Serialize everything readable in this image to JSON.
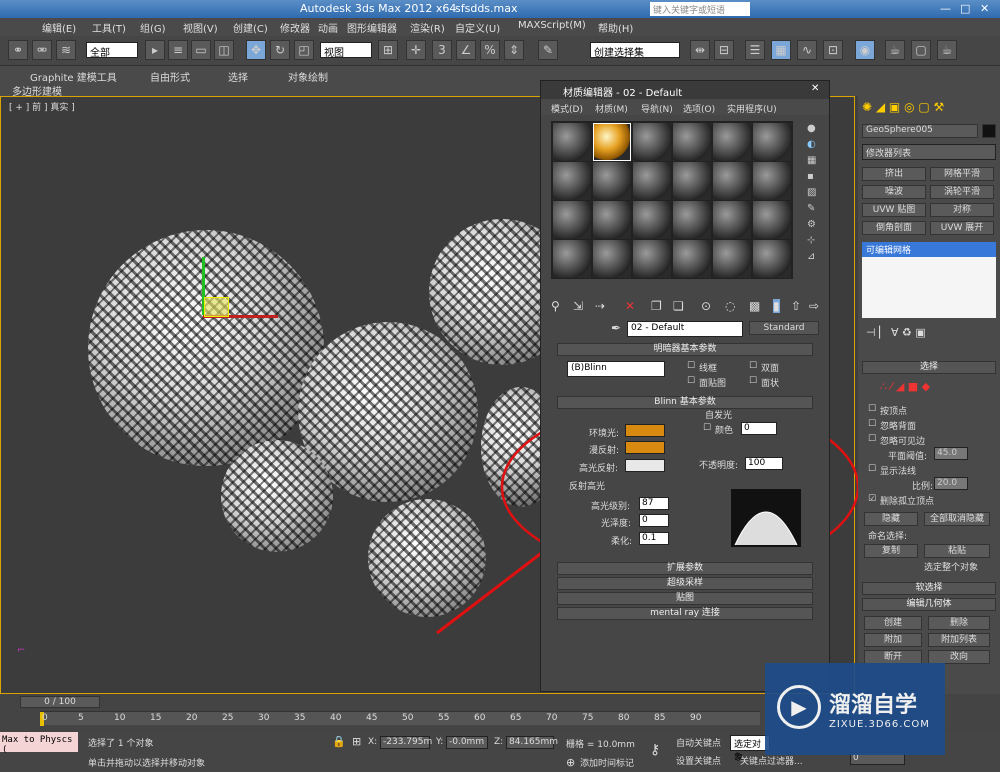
{
  "app": {
    "title": "Autodesk 3ds Max  2012 x64",
    "file": "sfsdds.max",
    "search_placeholder": "键入关键字或短语"
  },
  "menu": [
    "编辑(E)",
    "工具(T)",
    "组(G)",
    "视图(V)",
    "创建(C)",
    "修改器",
    "动画",
    "图形编辑器",
    "渲染(R)",
    "自定义(U)",
    "MAXScript(M)",
    "帮助(H)"
  ],
  "toolbar": {
    "selection_filter": "全部",
    "ref_coord": "视图",
    "named_sel": "创建选择集"
  },
  "ribbon": {
    "tabs": [
      "Graphite 建模工具",
      "自由形式",
      "选择",
      "对象绘制"
    ],
    "sub": "多边形建模"
  },
  "viewport": {
    "label": "[ + ] 前 ] 真实 ]"
  },
  "mat": {
    "title": "材质编辑器 - 02 - Default",
    "menu": [
      "模式(D)",
      "材质(M)",
      "导航(N)",
      "选项(O)",
      "实用程序(U)"
    ],
    "mat_name": "02 - Default",
    "mat_type": "Standard",
    "shader_hdr": "明暗器基本参数",
    "shader": "(B)Blinn",
    "wire": "线框",
    "two_sided": "双面",
    "face_map": "面贴图",
    "faceted": "面状",
    "blinn_hdr": "Blinn 基本参数",
    "self_illum": "自发光",
    "color": "颜色",
    "color_val": "0",
    "ambient": "环境光:",
    "diffuse": "漫反射:",
    "specular": "高光反射:",
    "opacity": "不透明度:",
    "opacity_val": "100",
    "spec_hl": "反射高光",
    "spec_level": "高光级别:",
    "spec_level_val": "87",
    "gloss": "光泽度:",
    "gloss_val": "0",
    "soften": "柔化:",
    "soften_val": "0.1",
    "rollouts": [
      "扩展参数",
      "超级采样",
      "贴图",
      "mental ray 连接"
    ]
  },
  "panel": {
    "obj_name": "GeoSphere005",
    "mod_list": "修改器列表",
    "buttons": [
      "挤出",
      "网格平滑",
      "噪波",
      "涡轮平滑",
      "UVW 贴图",
      "对称",
      "倒角剖面",
      "UVW 展开"
    ],
    "stack_item": "可编辑网格",
    "sel_hdr": "选择",
    "checks": [
      "按顶点",
      "忽略背面",
      "忽略可见边"
    ],
    "plane_thresh": "平面阈值:",
    "plane_val": "45.0",
    "show_normals": "显示法线",
    "scale": "比例:",
    "scale_val": "20.0",
    "del_iso": "删除孤立顶点",
    "hide": "隐藏",
    "unhide_all": "全部取消隐藏",
    "named_sel": "命名选择:",
    "copy": "复制",
    "paste": "粘贴",
    "sel_whole": "选定整个对象",
    "soft_sel": "软选择",
    "edit_geo": "编辑几何体",
    "geo_btns": [
      "创建",
      "删除",
      "附加",
      "附加列表",
      "断开",
      "改向"
    ]
  },
  "time": {
    "frame": "0 / 100",
    "ticks": [
      "0",
      "5",
      "10",
      "15",
      "20",
      "25",
      "30",
      "35",
      "40",
      "45",
      "50",
      "55",
      "60",
      "65",
      "70",
      "75",
      "80",
      "85",
      "90"
    ]
  },
  "status": {
    "script": "Max to Physcs (",
    "msg1": "选择了 1 个对象",
    "msg2": "单击并拖动以选择并移动对象",
    "x": "-233.795m",
    "y": "-0.0mm",
    "z": "84.165mm",
    "grid": "栅格 = 10.0mm",
    "autokey": "自动关键点",
    "set_key": "设置关键点",
    "sel_obj": "选定对象",
    "key_filter": "关键点过滤器...",
    "add_tag": "添加时间标记",
    "frame_val": "0"
  },
  "watermark": {
    "brand": "溜溜自学",
    "url": "ZIXUE.3D66.COM"
  }
}
